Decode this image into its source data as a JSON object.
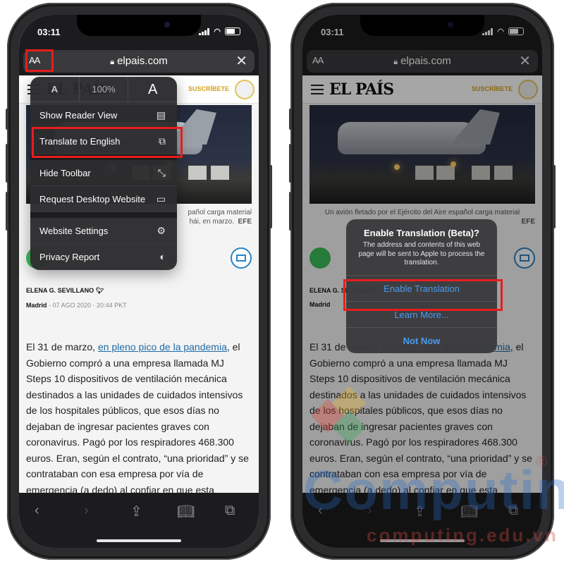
{
  "status": {
    "time": "03:11"
  },
  "urlbar": {
    "aa_label": "AA",
    "domain": "elpais.com",
    "close": "✕"
  },
  "site": {
    "logo": "EL PAÍS",
    "subscribe": "SUSCRÍBETE"
  },
  "caption": {
    "left_partial": "pañol carga material",
    "left_partial2": "hái, en marzo.",
    "full": "Un avión fletado por el Ejército del Aire español carga material",
    "credit": "EFE"
  },
  "byline": {
    "author": "ELENA G. SEVILLANO",
    "city": "Madrid",
    "date": " - 07 AGO 2020 - 20:44 PKT"
  },
  "article": {
    "p_start": "El 31 de marzo, ",
    "p_link": "en pleno pico de la pandemia",
    "p_rest": ", el Gobierno compró a una empresa llamada MJ Steps 10 dispositivos de ventilación mecánica destinados a las unidades de cuidados intensivos de los hospitales públicos, que esos días no dejaban de ingresar pacientes graves con coronavirus. Pagó por los respiradores 468.300 euros. Eran, según el contrato, “una prioridad” y se contrataban con esa empresa por vía de emergencia (a dedo) al confiar en que esta"
  },
  "format_menu": {
    "zoom_small": "A",
    "zoom_level": "100%",
    "zoom_big": "A",
    "items": [
      {
        "label": "Show Reader View",
        "icon": "reader-icon"
      },
      {
        "label": "Translate to English",
        "icon": "translate-icon"
      },
      {
        "label": "Hide Toolbar",
        "icon": "expand-icon"
      },
      {
        "label": "Request Desktop Website",
        "icon": "desktop-icon"
      },
      {
        "label": "Website Settings",
        "icon": "settings-icon"
      },
      {
        "label": "Privacy Report",
        "icon": "shield-icon"
      }
    ]
  },
  "dialog": {
    "title": "Enable Translation (Beta)?",
    "message": "The address and contents of this web page will be sent to Apple to process the translation.",
    "enable": "Enable Translation",
    "learn": "Learn More...",
    "not_now": "Not Now"
  },
  "watermark": {
    "main": "Computing",
    "sub": "computing.edu.vn",
    "reg": "®"
  },
  "colors": {
    "highlight": "#e81d1d",
    "link": "#1f6aa5",
    "ios_blue": "#4a9cf0",
    "subscribe": "#d4a017"
  }
}
